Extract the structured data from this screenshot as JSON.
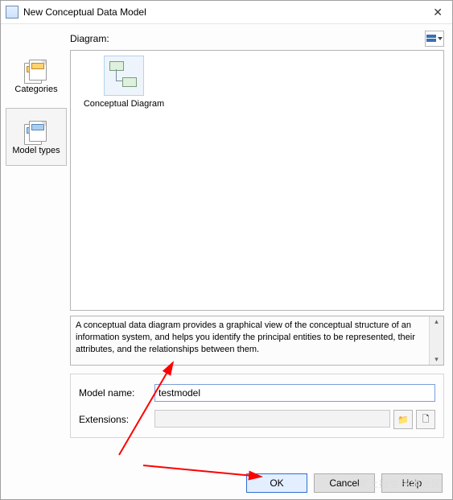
{
  "window": {
    "title": "New Conceptual Data Model"
  },
  "sidebar": {
    "items": [
      {
        "label": "Categories"
      },
      {
        "label": "Model types"
      }
    ]
  },
  "diagram": {
    "label": "Diagram:",
    "items": [
      {
        "label": "Conceptual Diagram"
      }
    ]
  },
  "description": "A conceptual data diagram provides a graphical view of the conceptual structure of an information system, and helps you identify the principal entities to be represented, their attributes, and the relationships between them.",
  "form": {
    "model_name_label": "Model name:",
    "model_name_value": "testmodel",
    "extensions_label": "Extensions:",
    "extensions_value": ""
  },
  "buttons": {
    "ok": "OK",
    "cancel": "Cancel",
    "help": "Help"
  }
}
